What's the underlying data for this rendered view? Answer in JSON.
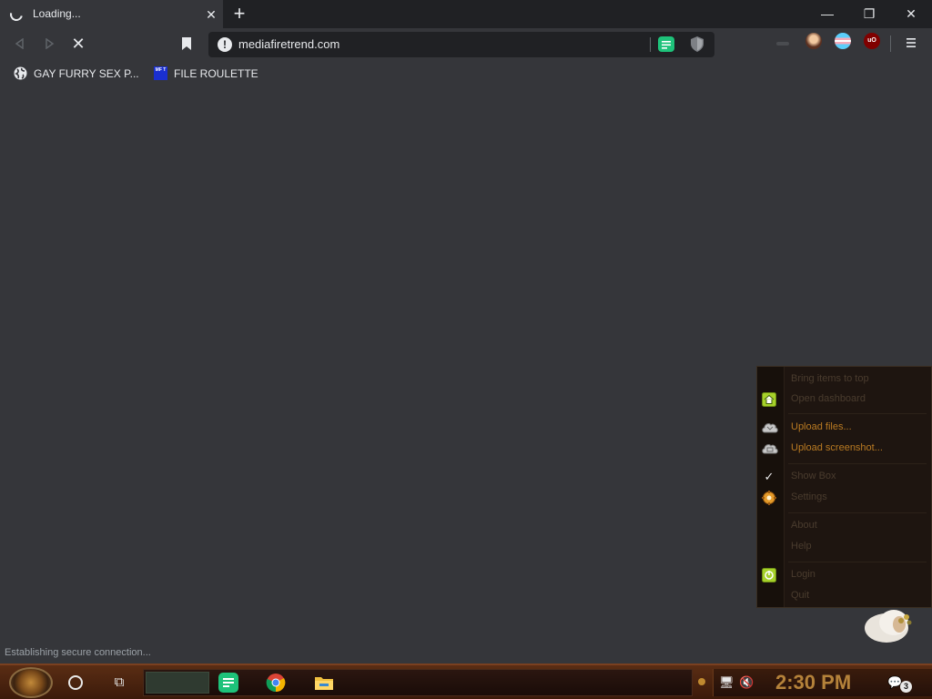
{
  "tab": {
    "title": "Loading...",
    "close_icon": "close-icon"
  },
  "window_controls": {
    "minimize": "—",
    "maximize": "❐",
    "close": "✕"
  },
  "newtab_label": "+",
  "toolbar": {
    "back_icon": "back-arrow-icon",
    "forward_icon": "forward-arrow-icon",
    "stop_glyph": "✕",
    "url": "mediafiretrend.com",
    "security_glyph": "!"
  },
  "bookmarks": [
    {
      "label": "GAY FURRY SEX P...",
      "icon": "globe-icon"
    },
    {
      "label": "FILE ROULETTE",
      "icon": "mft-favicon",
      "icon_text": "MF T"
    }
  ],
  "status": "Establishing secure connection...",
  "context_menu": {
    "items": [
      {
        "label": "Bring items to top",
        "icon": "",
        "enabled": false
      },
      {
        "label": "Open dashboard",
        "icon": "home-icon",
        "enabled": false
      },
      {
        "label": "Upload files...",
        "icon": "cloud-upload-icon",
        "enabled": true
      },
      {
        "label": "Upload screenshot...",
        "icon": "cloud-screenshot-icon",
        "enabled": true
      },
      {
        "label": "Show Box",
        "icon": "checkmark-icon",
        "enabled": false
      },
      {
        "label": "Settings",
        "icon": "gear-icon",
        "enabled": false
      },
      {
        "label": "About",
        "icon": "",
        "enabled": false
      },
      {
        "label": "Help",
        "icon": "",
        "enabled": false
      },
      {
        "label": "Login",
        "icon": "power-icon",
        "enabled": false
      },
      {
        "label": "Quit",
        "icon": "",
        "enabled": false
      }
    ]
  },
  "taskbar": {
    "clock": "2:30 PM",
    "notification_count": "3",
    "taskview_glyph": "⧉",
    "network_glyph": "🖥",
    "volume_glyph": "🔇",
    "notif_glyph": "💬",
    "caret_glyph": "⌃"
  },
  "colors": {
    "chrome_dark": "#202124",
    "chrome_mid": "#35363a",
    "menu_enabled": "#b97a22",
    "clock": "#b5823a"
  }
}
